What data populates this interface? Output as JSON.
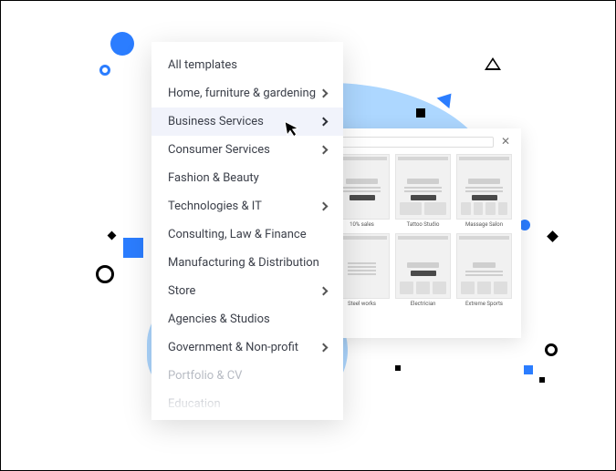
{
  "menu": {
    "items": [
      {
        "label": "All templates",
        "has_children": false,
        "hovered": false,
        "faded": false
      },
      {
        "label": "Home, furniture & gardening",
        "has_children": true,
        "hovered": false,
        "faded": false
      },
      {
        "label": "Business Services",
        "has_children": true,
        "hovered": true,
        "faded": false
      },
      {
        "label": "Consumer Services",
        "has_children": true,
        "hovered": false,
        "faded": false
      },
      {
        "label": "Fashion & Beauty",
        "has_children": false,
        "hovered": false,
        "faded": false
      },
      {
        "label": "Technologies & IT",
        "has_children": true,
        "hovered": false,
        "faded": false
      },
      {
        "label": "Consulting, Law & Finance",
        "has_children": false,
        "hovered": false,
        "faded": false
      },
      {
        "label": "Manufacturing & Distribution",
        "has_children": false,
        "hovered": false,
        "faded": false
      },
      {
        "label": "Store",
        "has_children": true,
        "hovered": false,
        "faded": false
      },
      {
        "label": "Agencies & Studios",
        "has_children": false,
        "hovered": false,
        "faded": false
      },
      {
        "label": "Government & Non-profit",
        "has_children": true,
        "hovered": false,
        "faded": false
      },
      {
        "label": "Portfolio & CV",
        "has_children": false,
        "hovered": false,
        "faded": true
      },
      {
        "label": "Education",
        "has_children": false,
        "hovered": false,
        "faded": true
      }
    ]
  },
  "gallery": {
    "search_placeholder": "",
    "cards": [
      {
        "caption": "10% sales"
      },
      {
        "caption": "Tattoo Studio"
      },
      {
        "caption": "Massage Salon"
      },
      {
        "caption": "Steel works"
      },
      {
        "caption": "Electrician"
      },
      {
        "caption": "Extreme Sports"
      }
    ]
  }
}
